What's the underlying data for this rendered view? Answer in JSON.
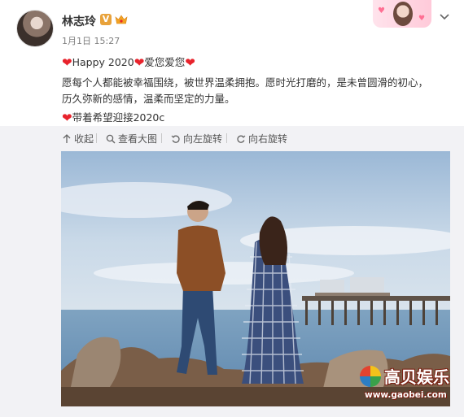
{
  "post": {
    "username": "林志玲",
    "verified_badge": "V",
    "time": "1月1日 15:27",
    "line1_text1": "Happy 2020",
    "line1_text2": "爱您爱您",
    "line2": "愿每个人都能被幸福围绕，被世界温柔拥抱。愿时光打磨的，是未曾圆滑的初心，",
    "line3": "历久弥新的感情，温柔而坚定的力量。",
    "line4": "带着希望迎接2020ⅽ"
  },
  "toolbar": {
    "collapse_label": "收起",
    "view_large_label": "查看大图",
    "rotate_left_label": "向左旋转",
    "rotate_right_label": "向右旋转"
  },
  "watermark": {
    "title": "高贝娱乐",
    "url": "www.gaobei.com"
  },
  "icons": {
    "heart": "heart-icon",
    "crown": "crown-icon",
    "chevron": "chevron-down-icon"
  },
  "colors": {
    "heart": "#e8232c",
    "toolbar_bg": "#f2f2f5",
    "verified": "#e8a23b"
  }
}
